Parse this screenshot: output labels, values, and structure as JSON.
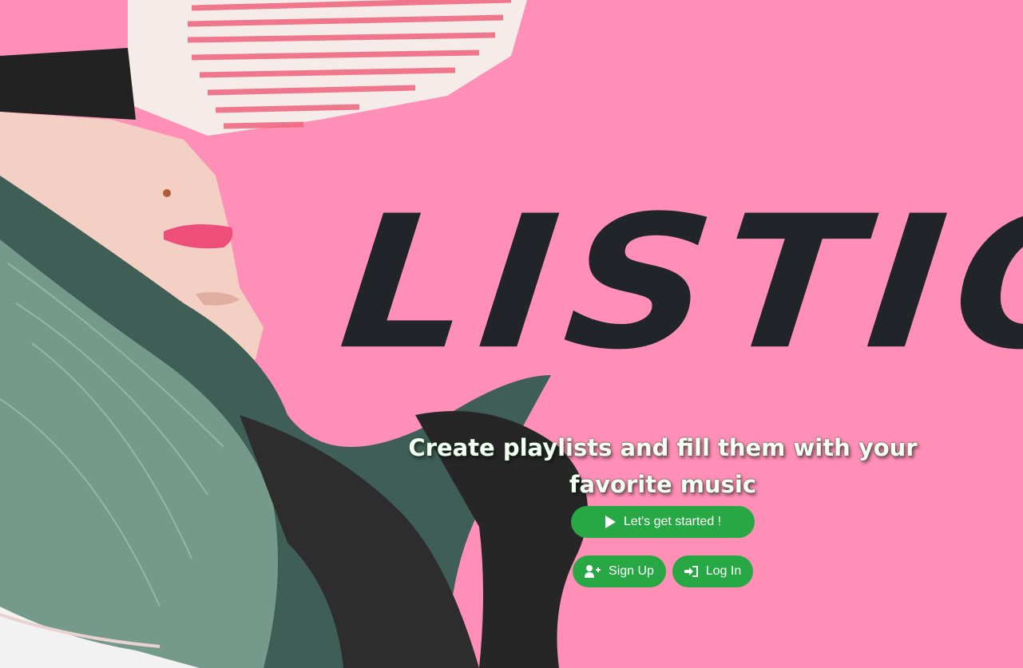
{
  "hero": {
    "logo_text": "Listio",
    "tagline": "Create playlists and fill them with your favorite music"
  },
  "buttons": {
    "start_label": "Let's get started !",
    "signup_label": "Sign Up",
    "login_label": "Log In"
  },
  "icons": {
    "start": "play-icon",
    "signup": "user-plus-icon",
    "login": "sign-in-icon"
  },
  "colors": {
    "background": "#ff8fb6",
    "button": "#28a745",
    "logo": "#212529"
  }
}
